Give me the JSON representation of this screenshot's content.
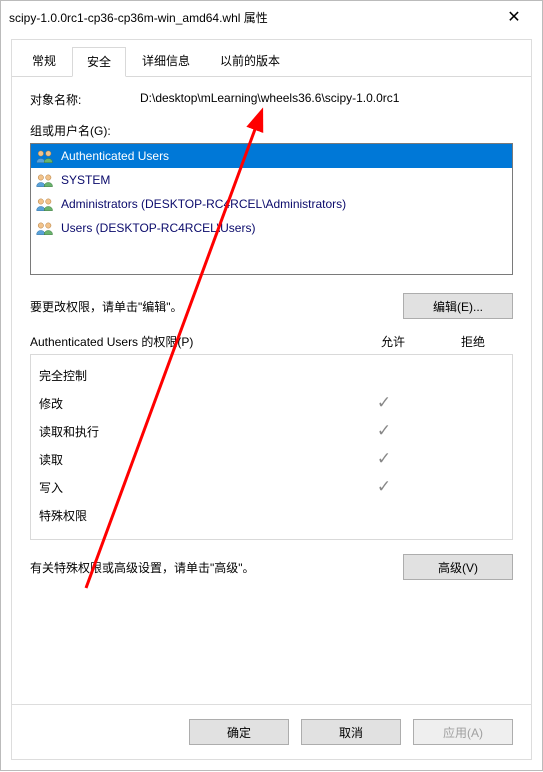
{
  "window": {
    "title": "scipy-1.0.0rc1-cp36-cp36m-win_amd64.whl 属性",
    "close_symbol": "✕"
  },
  "tabs": [
    {
      "label": "常规",
      "active": false
    },
    {
      "label": "安全",
      "active": true
    },
    {
      "label": "详细信息",
      "active": false
    },
    {
      "label": "以前的版本",
      "active": false
    }
  ],
  "object_name": {
    "label": "对象名称:",
    "value": "D:\\desktop\\mLearning\\wheels36.6\\scipy-1.0.0rc1"
  },
  "groups": {
    "label": "组或用户名(G):",
    "items": [
      {
        "name": "Authenticated Users",
        "selected": true
      },
      {
        "name": "SYSTEM",
        "selected": false
      },
      {
        "name": "Administrators (DESKTOP-RC4RCEL\\Administrators)",
        "selected": false
      },
      {
        "name": "Users (DESKTOP-RC4RCEL\\Users)",
        "selected": false
      }
    ]
  },
  "edit": {
    "text": "要更改权限，请单击\"编辑\"。",
    "button": "编辑(E)..."
  },
  "permissions": {
    "header_user": "Authenticated Users 的权限(P)",
    "header_allow": "允许",
    "header_deny": "拒绝",
    "rows": [
      {
        "name": "完全控制",
        "allow": false,
        "deny": false
      },
      {
        "name": "修改",
        "allow": true,
        "deny": false
      },
      {
        "name": "读取和执行",
        "allow": true,
        "deny": false
      },
      {
        "name": "读取",
        "allow": true,
        "deny": false
      },
      {
        "name": "写入",
        "allow": true,
        "deny": false
      },
      {
        "name": "特殊权限",
        "allow": false,
        "deny": false
      }
    ]
  },
  "advanced": {
    "text": "有关特殊权限或高级设置，请单击\"高级\"。",
    "button": "高级(V)"
  },
  "footer": {
    "ok": "确定",
    "cancel": "取消",
    "apply": "应用(A)"
  },
  "icons": {
    "check": "✓"
  }
}
